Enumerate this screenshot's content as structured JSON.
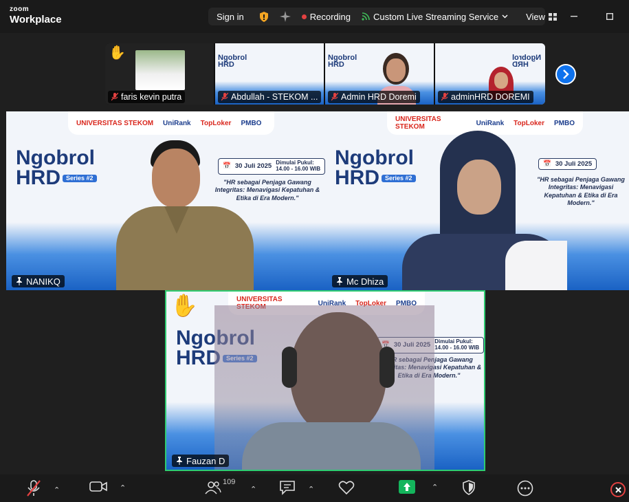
{
  "app": {
    "logo_top": "zoom",
    "logo_bottom": "Workplace"
  },
  "topbar": {
    "sign_in": "Sign in",
    "recording": "Recording",
    "streaming": "Custom Live Streaming Service",
    "view": "View"
  },
  "strip": [
    {
      "name": "faris kevin putra",
      "hand": true
    },
    {
      "name": "Abdullah - STEKOM ...",
      "hand": false
    },
    {
      "name": "Admin HRD Doremi",
      "hand": false
    },
    {
      "name": "adminHRD DOREMI",
      "hand": false
    }
  ],
  "slide": {
    "university": "UNIVERSITAS STEKOM",
    "unirank": "UniRank",
    "toploker": "TopLoker",
    "pmbo": "PMBO",
    "title_1": "Ngobrol",
    "title_2": "HRD",
    "series": "Series #2",
    "date": "30 Juli 2025",
    "time_label": "Dimulai Pukul:",
    "time": "14.00 - 16.00 WIB",
    "quote": "\"HR sebagai Penjaga Gawang Integritas: Menavigasi Kepatuhan & Etika di Era Modern.\""
  },
  "tiles": {
    "left": {
      "name": "NANIKQ"
    },
    "right": {
      "name": "Mc Dhiza"
    },
    "main": {
      "name": "Fauzan D"
    }
  },
  "toolbar": {
    "participants_count": "109"
  },
  "colors": {
    "accent": "#0e72ed",
    "active_speaker": "#2ecc71",
    "record": "#e34141",
    "share": "#14b55c"
  }
}
